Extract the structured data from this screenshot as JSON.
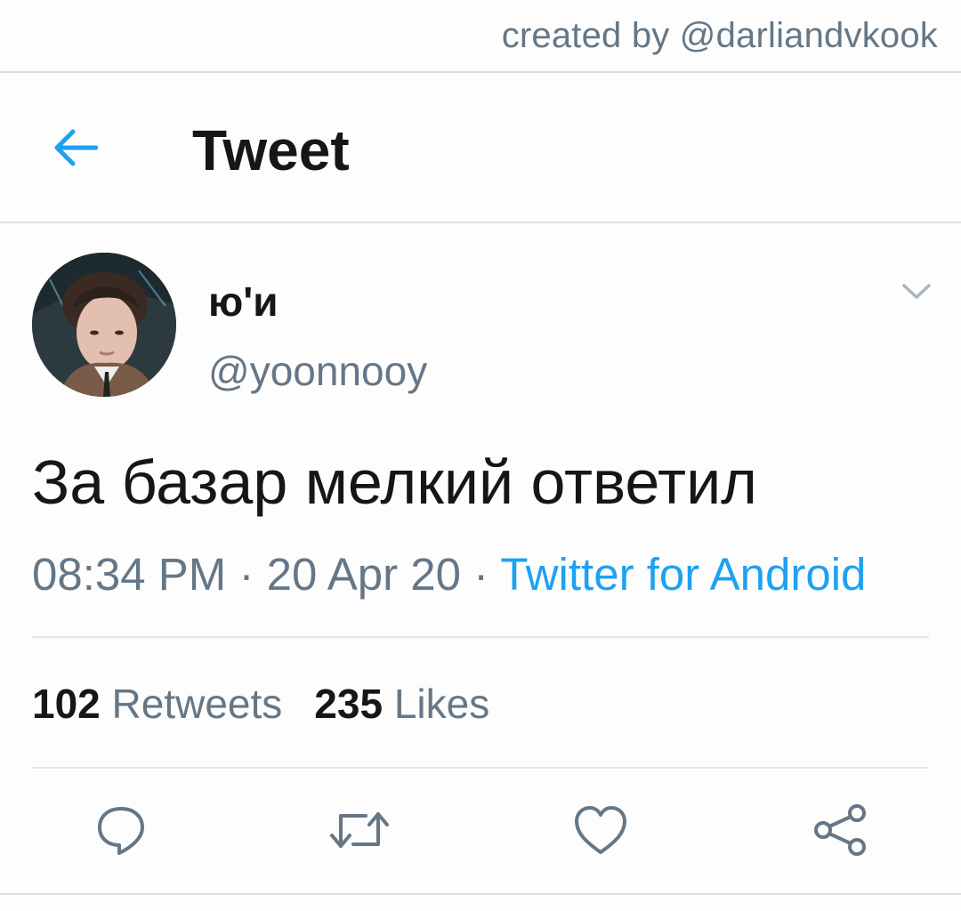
{
  "watermark": "created by @darliandvkook",
  "header": {
    "title": "Tweet",
    "back_icon": "arrow-left-icon"
  },
  "tweet": {
    "author": {
      "display_name": "ю'и",
      "handle": "@yoonnooy"
    },
    "text": "За базар мелкий ответил",
    "time": "08:34 PM",
    "separator": " · ",
    "date": "20 Apr 20",
    "source": "Twitter for Android"
  },
  "stats": {
    "retweets_count": "102",
    "retweets_label": "Retweets",
    "likes_count": "235",
    "likes_label": "Likes"
  },
  "actions": {
    "reply_icon": "speech-bubble-icon",
    "retweet_icon": "retweet-icon",
    "like_icon": "heart-icon",
    "share_icon": "share-icon"
  },
  "colors": {
    "accent": "#1da1f2",
    "secondary_text": "#657786",
    "primary_text": "#14171a",
    "divider": "#d7dde2"
  }
}
